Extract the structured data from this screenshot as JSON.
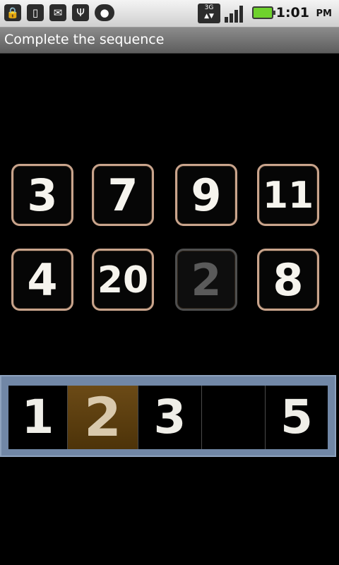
{
  "status": {
    "time": "1:01",
    "meridiem": "PM",
    "colors": {
      "battery": "#6fd22d"
    },
    "icons": [
      "lock-icon",
      "sim-card-icon",
      "gmail-icon",
      "usb-icon",
      "android-icon",
      "network-3g-icon",
      "signal-icon",
      "battery-icon"
    ]
  },
  "app": {
    "title": "Complete the sequence"
  },
  "grid": {
    "tiles": [
      "3",
      "7",
      "9",
      "11",
      "4",
      "20",
      "2",
      "8"
    ],
    "selected_index": 6,
    "colors": {
      "border": "#c9a48c",
      "selected_border": "#4e4e4e"
    }
  },
  "answer": {
    "slots": [
      "1",
      "2",
      "3",
      "",
      "5"
    ],
    "active_index": 1,
    "colors": {
      "bar": "#7187a6",
      "active": "#6b4a16"
    }
  }
}
